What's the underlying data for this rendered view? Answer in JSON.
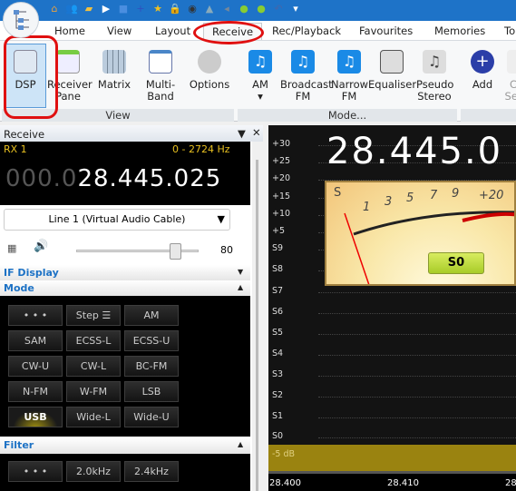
{
  "quick_access": [
    "home-icon",
    "users-icon",
    "folder-icon",
    "play-icon",
    "stop-icon",
    "add-icon",
    "star-icon",
    "lock-icon",
    "camera-icon",
    "cone-icon",
    "speaker-icon",
    "green-dot-icon",
    "green-dot-icon",
    "undo-icon",
    "dropdown-icon"
  ],
  "tabs": [
    "Home",
    "View",
    "Layout",
    "Receive",
    "Rec/Playback",
    "Favourites",
    "Memories",
    "To"
  ],
  "active_tab": "Receive",
  "ribbon": {
    "view_group": {
      "label": "View",
      "items": [
        "DSP",
        "Receiver Pane",
        "Matrix",
        "Multi-Band",
        "Options"
      ]
    },
    "mode_group": {
      "label": "Mode...",
      "items": [
        "AM",
        "Broadcast FM",
        "Narrow FM",
        "Equaliser",
        "Pseudo Stereo"
      ]
    },
    "add": {
      "label": "Add",
      "partial": "C",
      "partial2": "Set"
    }
  },
  "pane": {
    "title": "Receive",
    "rx_label": "RX 1",
    "range": "0 - 2724 Hz",
    "freq_dim": "000.0",
    "freq": "28.445.025",
    "audio_device": "Line 1 (Virtual Audio Cable)",
    "volume": 80,
    "volume_label": "80",
    "if_display": "IF Display",
    "mode_section": "Mode",
    "mode_buttons": [
      "• • •",
      "Step ☰",
      "AM",
      "SAM",
      "ECSS-L",
      "ECSS-U",
      "CW-U",
      "CW-L",
      "BC-FM",
      "N-FM",
      "W-FM",
      "LSB",
      "USB",
      "Wide-L",
      "Wide-U"
    ],
    "active_mode": "USB",
    "filter_section": "Filter",
    "filter_buttons": [
      "• • •",
      "2.0kHz",
      "2.4kHz"
    ]
  },
  "spectrum": {
    "freq": "28.445.0",
    "scale": [
      "+30",
      "+25",
      "+20",
      "+15",
      "+10",
      "+5",
      "S9",
      "S8",
      "S7",
      "S6",
      "S5",
      "S4",
      "S3",
      "S2",
      "S1",
      "S0"
    ],
    "floor_label": "-5 dB",
    "axis": [
      "28.400",
      "28.410",
      "28"
    ],
    "meter": {
      "s_label": "S",
      "ticks": [
        "1",
        "3",
        "5",
        "7",
        "9",
        "+20"
      ],
      "reading": "S0"
    }
  },
  "colors": {
    "accent": "#1e73c8",
    "band": "#9a8310",
    "annotation": "#e01010"
  }
}
